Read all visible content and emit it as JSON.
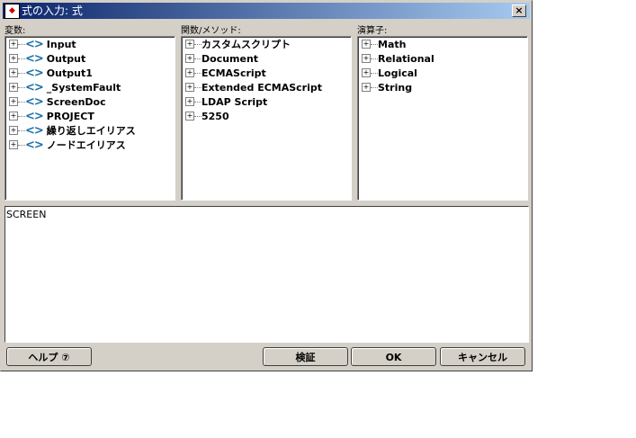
{
  "window": {
    "title": "式の入力: 式",
    "close": "×"
  },
  "panels": [
    {
      "label": "変数:",
      "items": [
        "Input",
        "Output",
        "Output1",
        "_SystemFault",
        "ScreenDoc",
        "PROJECT",
        "繰り返しエイリアス",
        "ノードエイリアス"
      ]
    },
    {
      "label": "関数/メソッド:",
      "items": [
        "カスタムスクリプト",
        "Document",
        "ECMAScript",
        "Extended ECMAScript",
        "LDAP Script",
        "5250"
      ]
    },
    {
      "label": "演算子:",
      "items": [
        "Math",
        "Relational",
        "Logical",
        "String"
      ]
    }
  ],
  "expression": "SCREEN",
  "buttons": {
    "help": "ヘルプ ⑦",
    "validate": "検証",
    "ok": "OK",
    "cancel": "キャンセル"
  }
}
